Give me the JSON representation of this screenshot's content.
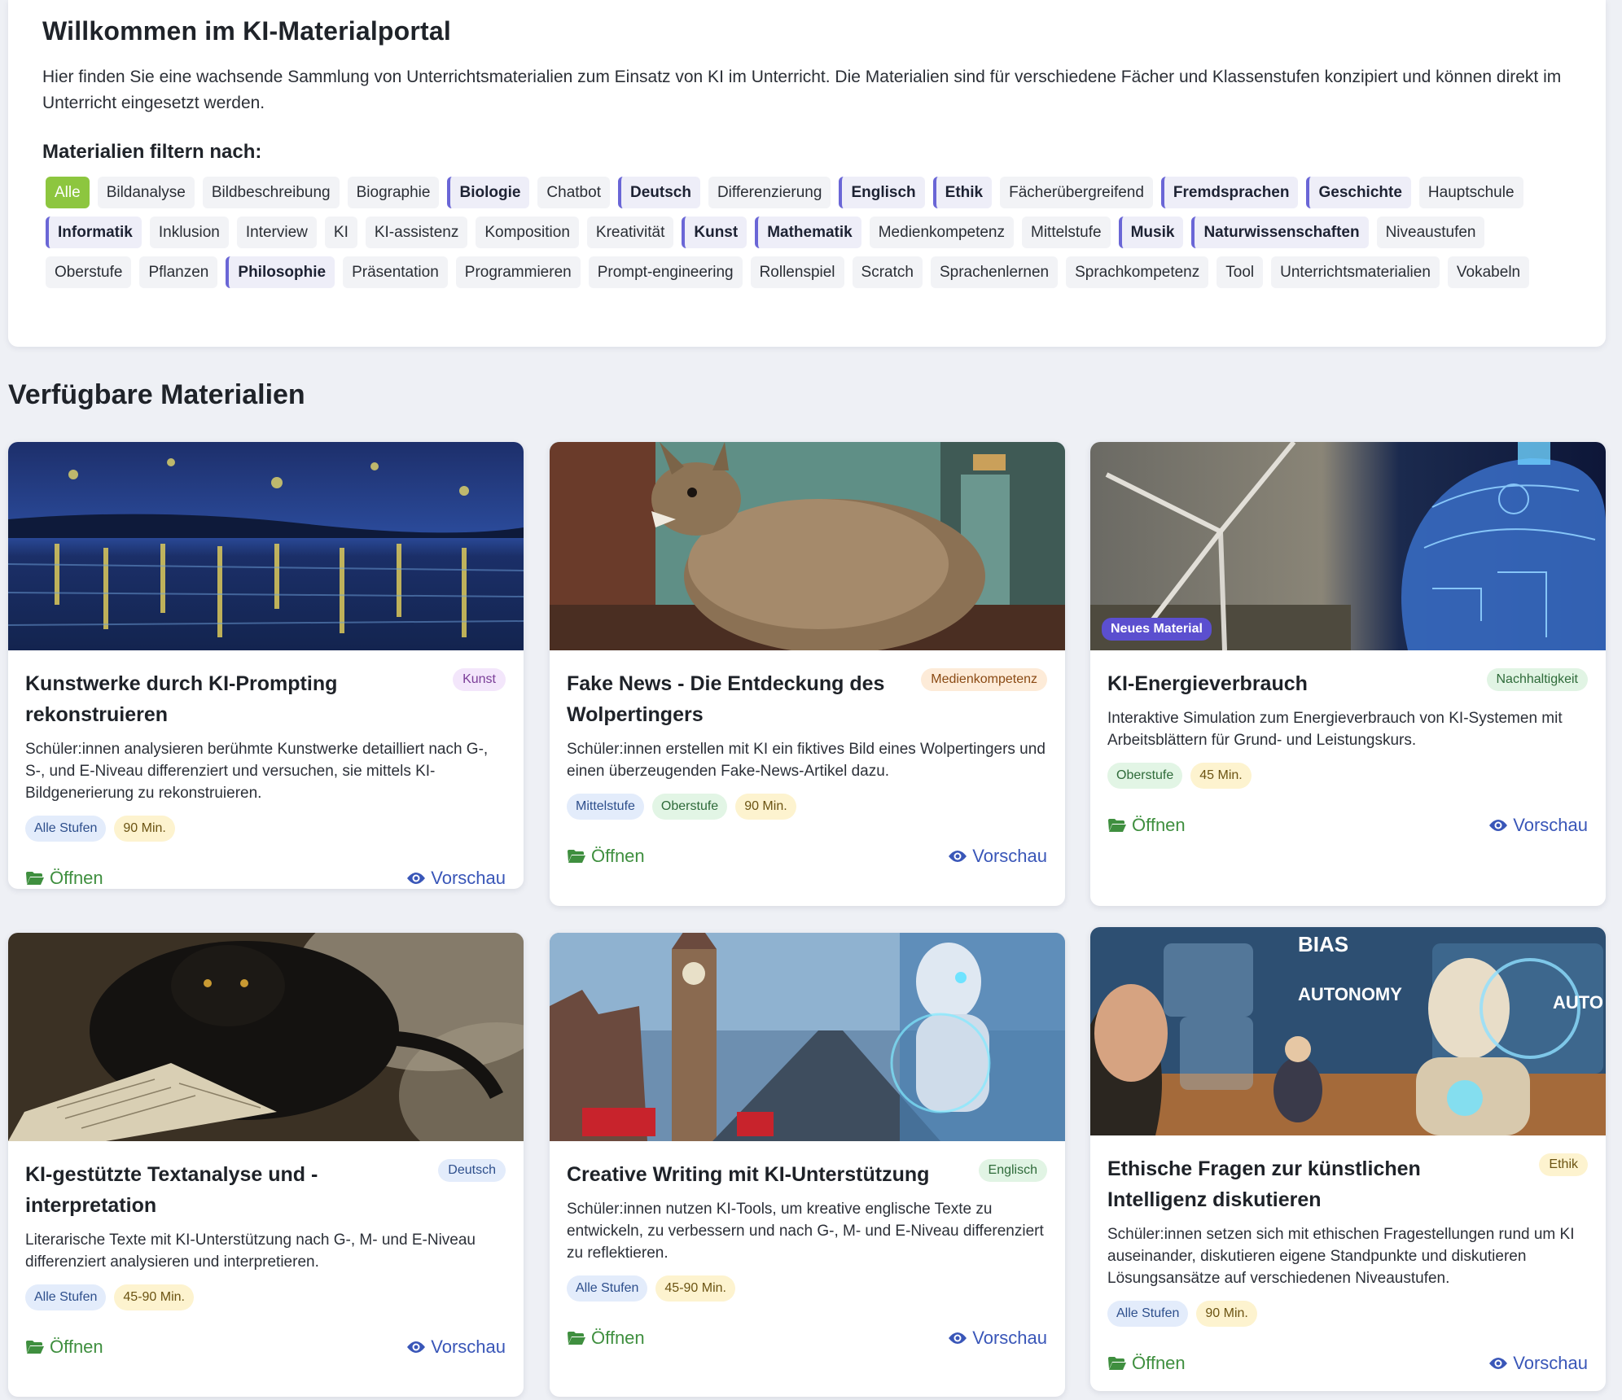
{
  "intro": {
    "title": "Willkommen im KI-Materialportal",
    "lead": "Hier finden Sie eine wachsende Sammlung von Unterrichtsmaterialien zum Einsatz von KI im Unterricht. Die Materialien sind für verschiedene Fächer und Klassenstufen konzipiert und können direkt im Unterricht eingesetzt werden.",
    "filter_heading": "Materialien filtern nach:"
  },
  "tags": [
    {
      "label": "Alle",
      "type": "active"
    },
    {
      "label": "Bildanalyse",
      "type": "plain"
    },
    {
      "label": "Bildbeschreibung",
      "type": "plain"
    },
    {
      "label": "Biographie",
      "type": "plain"
    },
    {
      "label": "Biologie",
      "type": "subject"
    },
    {
      "label": "Chatbot",
      "type": "plain"
    },
    {
      "label": "Deutsch",
      "type": "subject"
    },
    {
      "label": "Differenzierung",
      "type": "plain"
    },
    {
      "label": "Englisch",
      "type": "subject"
    },
    {
      "label": "Ethik",
      "type": "subject"
    },
    {
      "label": "Fächerübergreifend",
      "type": "plain"
    },
    {
      "label": "Fremdsprachen",
      "type": "subject"
    },
    {
      "label": "Geschichte",
      "type": "subject"
    },
    {
      "label": "Hauptschule",
      "type": "plain"
    },
    {
      "label": "Informatik",
      "type": "subject"
    },
    {
      "label": "Inklusion",
      "type": "plain"
    },
    {
      "label": "Interview",
      "type": "plain"
    },
    {
      "label": "KI",
      "type": "plain"
    },
    {
      "label": "KI-assistenz",
      "type": "plain"
    },
    {
      "label": "Komposition",
      "type": "plain"
    },
    {
      "label": "Kreativität",
      "type": "plain"
    },
    {
      "label": "Kunst",
      "type": "subject"
    },
    {
      "label": "Mathematik",
      "type": "subject"
    },
    {
      "label": "Medienkompetenz",
      "type": "plain"
    },
    {
      "label": "Mittelstufe",
      "type": "plain"
    },
    {
      "label": "Musik",
      "type": "subject"
    },
    {
      "label": "Naturwissenschaften",
      "type": "subject"
    },
    {
      "label": "Niveaustufen",
      "type": "plain"
    },
    {
      "label": "Oberstufe",
      "type": "plain"
    },
    {
      "label": "Pflanzen",
      "type": "plain"
    },
    {
      "label": "Philosophie",
      "type": "subject"
    },
    {
      "label": "Präsentation",
      "type": "plain"
    },
    {
      "label": "Programmieren",
      "type": "plain"
    },
    {
      "label": "Prompt-engineering",
      "type": "plain"
    },
    {
      "label": "Rollenspiel",
      "type": "plain"
    },
    {
      "label": "Scratch",
      "type": "plain"
    },
    {
      "label": "Sprachenlernen",
      "type": "plain"
    },
    {
      "label": "Sprachkompetenz",
      "type": "plain"
    },
    {
      "label": "Tool",
      "type": "plain"
    },
    {
      "label": "Unterrichtsmaterialien",
      "type": "plain"
    },
    {
      "label": "Vokabeln",
      "type": "plain"
    }
  ],
  "section_title": "Verfügbare Materialien",
  "actions": {
    "open": "Öffnen",
    "preview": "Vorschau"
  },
  "new_badge": "Neues Material",
  "colors": {
    "accent": "#8dc63f",
    "subject_border": "#6a66d6",
    "open": "#3f8f3f",
    "preview": "#3956b8"
  },
  "cards": [
    {
      "title": "Kunstwerke durch KI-Prompting rekonstruieren",
      "subject": "Kunst",
      "desc": "Schüler:innen analysieren berühmte Kunstwerke detailliert nach G-, S-, und E-Niveau differenziert und versuchen, sie mittels KI-Bildgenerierung zu rekonstruieren.",
      "pills": [
        "Alle Stufen",
        "90 Min."
      ],
      "image": "starry-night-painting"
    },
    {
      "title": "Fake News - Die Entdeckung des Wolpertingers",
      "subject": "Medienkompetenz",
      "desc": "Schüler:innen erstellen mit KI ein fiktives Bild eines Wolpertingers und einen überzeugenden Fake-News-Artikel dazu.",
      "pills": [
        "Mittelstufe",
        "Oberstufe",
        "90 Min."
      ],
      "image": "wolpertinger-photo"
    },
    {
      "title": "KI-Energieverbrauch",
      "subject": "Nachhaltigkeit",
      "desc": "Interaktive Simulation zum Energieverbrauch von KI-Systemen mit Arbeitsblättern für Grund- und Leistungskurs.",
      "pills": [
        "Oberstufe",
        "45 Min."
      ],
      "image": "wind-turbine-ai-head"
    },
    {
      "title": "KI-gestützte Textanalyse und -interpretation",
      "subject": "Deutsch",
      "desc": "Literarische Texte mit KI-Unterstützung nach G-, M- und E-Niveau differenziert analysieren und interpretieren.",
      "pills": [
        "Alle Stufen",
        "45-90 Min."
      ],
      "image": "panther-with-book"
    },
    {
      "title": "Creative Writing mit KI-Unterstützung",
      "subject": "Englisch",
      "desc": "Schüler:innen nutzen KI-Tools, um kreative englische Texte zu entwickeln, zu verbessern und nach G-, M- und E-Niveau differenziert zu reflektieren.",
      "pills": [
        "Alle Stufen",
        "45-90 Min."
      ],
      "image": "london-robot"
    },
    {
      "title": "Ethische Fragen zur künstlichen Intelligenz diskutieren",
      "subject": "Ethik",
      "desc": "Schüler:innen setzen sich mit ethischen Fragestellungen rund um KI auseinander, diskutieren eigene Standpunkte und diskutieren Lösungsansätze auf verschiedenen Niveaustufen.",
      "pills": [
        "Alle Stufen",
        "90 Min."
      ],
      "image": "ethics-robot",
      "image_text": [
        "BIAS",
        "AUTONOMY",
        "AUTO"
      ]
    }
  ]
}
